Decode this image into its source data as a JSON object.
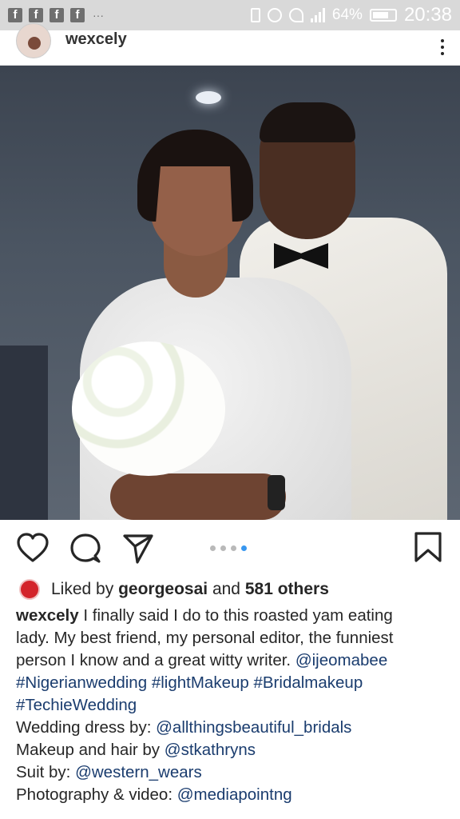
{
  "status_bar": {
    "notification_icons": [
      "f",
      "f",
      "f",
      "f"
    ],
    "overflow": "···",
    "battery": "64%",
    "time": "20:38"
  },
  "post": {
    "username": "wexcely",
    "more_icon": "more-vertical-icon",
    "photo": {
      "description_icon": "wedding-photo"
    },
    "carousel": {
      "count": 4,
      "active_index": 3,
      "active_color": "#3897f0"
    },
    "likes": {
      "prefix": "Liked by",
      "user": "georgeosai",
      "joiner": "and",
      "others": "581 others"
    },
    "caption": {
      "author": "wexcely",
      "lines": [
        " I finally said I do to this roasted yam eating",
        "lady. My best friend, my personal editor, the funniest",
        "person I know and a great witty writer. "
      ],
      "mention": "@ijeomabee",
      "hashtags_line1": [
        "#Nigerianwedding",
        "#lightMakeup",
        "#Bridalmakeup"
      ],
      "hashtag_line2": "#TechieWedding",
      "credits": [
        {
          "label": "Wedding dress by: ",
          "handle": "@allthingsbeautiful_bridals"
        },
        {
          "label": "Makeup and hair by ",
          "handle": "@stkathryns"
        },
        {
          "label": "Suit by: ",
          "handle": "@western_wears"
        },
        {
          "label": "Photography & video: ",
          "handle": "@mediapointng"
        }
      ]
    }
  },
  "colors": {
    "link": "#1a3c6e",
    "text": "#262626",
    "status_bar": "#d9d9d9"
  }
}
